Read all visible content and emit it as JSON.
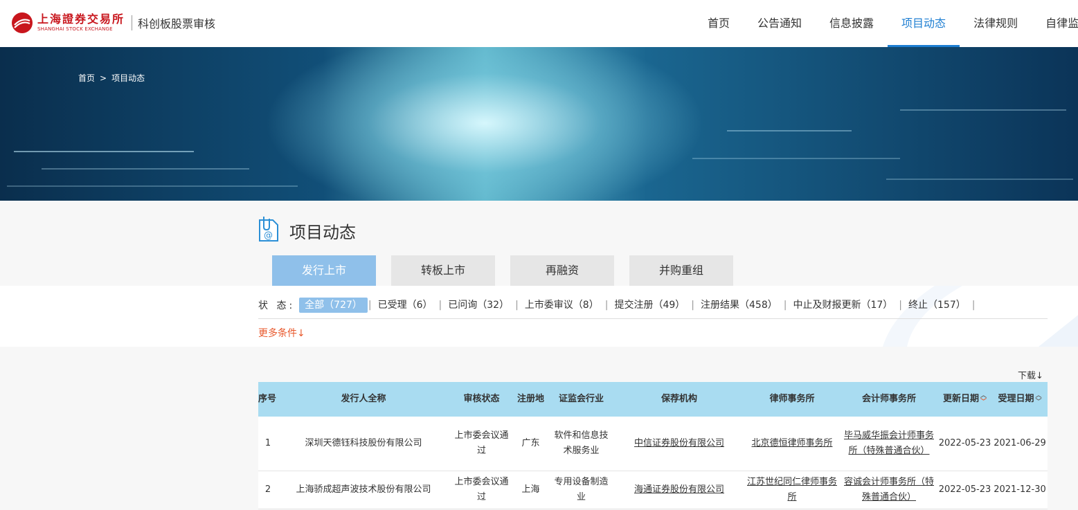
{
  "header": {
    "logo_cn": "上海證券交易所",
    "logo_en": "SHANGHAI STOCK EXCHANGE",
    "subtitle": "科创板股票审核",
    "nav": [
      "首页",
      "公告通知",
      "信息披露",
      "项目动态",
      "法律规则",
      "自律监"
    ],
    "active_nav": "项目动态",
    "accent_color": "#1d7ed2",
    "brand_color": "#c8161d"
  },
  "breadcrumb": {
    "home": "首页",
    "separator": ">",
    "current": "项目动态"
  },
  "page": {
    "title": "项目动态",
    "title_icon": "document-attachment-icon"
  },
  "tabs": [
    "发行上市",
    "转板上市",
    "再融资",
    "并购重组"
  ],
  "filter": {
    "label": "状  态:",
    "statuses": [
      "全部（727）",
      "已受理（6）",
      "已问询（32）",
      "上市委审议（8）",
      "提交注册（49）",
      "注册结果（458）",
      "中止及财报更新（17）",
      "终止（157）"
    ],
    "more": "更多条件↓"
  },
  "table": {
    "download": "下载↓",
    "headers": [
      "序号",
      "发行人全称",
      "审核状态",
      "注册地",
      "证监会行业",
      "保荐机构",
      "律师事务所",
      "会计师事务所",
      "更新日期",
      "受理日期"
    ],
    "rows": [
      {
        "no": "1",
        "company": "深圳天德钰科技股份有限公司",
        "status": "上市委会议通过",
        "region": "广东",
        "industry": "软件和信息技术服务业",
        "sponsor": "中信证券股份有限公司",
        "law_firm": "北京德恒律师事务所",
        "accounting": "毕马威华振会计师事务所（特殊普通合伙）",
        "updated": "2022-05-23",
        "accepted": "2021-06-29"
      },
      {
        "no": "2",
        "company": "上海骄成超声波技术股份有限公司",
        "status": "上市委会议通过",
        "region": "上海",
        "industry": "专用设备制造业",
        "sponsor": "海通证券股份有限公司",
        "law_firm": "江苏世纪同仁律师事务所",
        "accounting": "容诚会计师事务所（特殊普通合伙）",
        "updated": "2022-05-23",
        "accepted": "2021-12-30"
      }
    ]
  }
}
